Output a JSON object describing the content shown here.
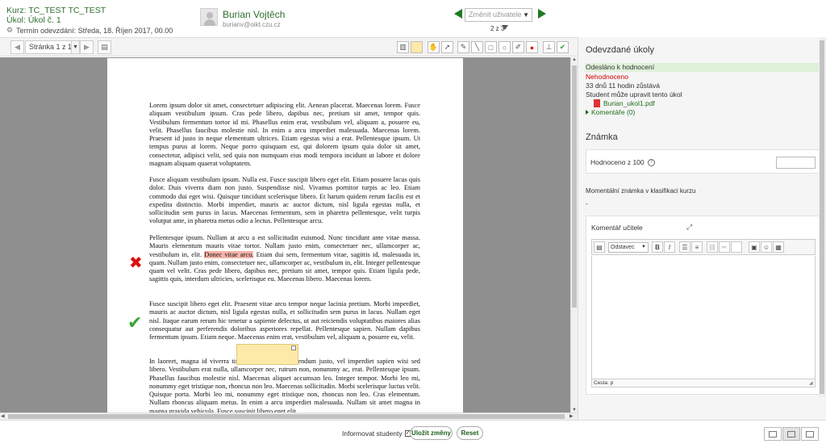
{
  "header": {
    "course": "Kurz: TC_TEST TC_TEST",
    "task": "Úkol: Úkol č. 1",
    "deadline": "Termín odevzdání: Středa, 18. Říjen 2017, 00.00",
    "student_name": "Burian Vojtěch",
    "student_email": "burianv@oikt.czu.cz",
    "change_user_placeholder": "Změnit uživatele",
    "user_count": "2 z 3"
  },
  "toolbar": {
    "page_label": "Stránka 1 z 1"
  },
  "document": {
    "para1": "Lorem ipsum dolor sit amet, consectetuer adipiscing elit. Aenean placerat. Maecenas lorem. Fusce aliquam vestibulum ipsum. Cras pede libero, dapibus nec, pretium sit amet, tempor quis. Vestibulum fermentum tortor id mi. Phasellus enim erat, vestibulum vel, aliquam a, posuere eu, velit. Phasellus faucibus molestie nisl. In enim a arcu imperdiet malesuada. Maecenas lorem. Praesent id justo in neque elementum ultrices. Etiam egestas wisi a erat. Pellentesque ipsum. Ut tempus purus at lorem. Neque porro quisquam est, qui dolorem ipsum quia dolor sit amet, consectetur, adipisci velit, sed quia non numquam eius modi tempora incidunt ut labore et dolore magnam aliquam quaerat voluptatem.",
    "para2": "Fusce aliquam vestibulum ipsum. Nulla est. Fusce suscipit libero eget elit. Etiam posuere lacus quis dolor. Duis viverra diam non justo. Suspendisse nisl. Vivamus porttitor turpis ac leo. Etiam commodo dui eget wisi. Quisque tincidunt scelerisque libero. Et harum quidem rerum facilis est et expedita distinctio. Morbi imperdiet, mauris ac auctor dictum, nisl ligula egestas nulla, et sollicitudin sem purus in lacus. Maecenas fermentum, sem in pharetra pellentesque, velit turpis volutpat ante, in pharetra metus odio a lectus. Pellentesque arcu.",
    "para3_before": "Pellentesque ipsum. Nullam at arcu a est sollicitudin euismod. Nunc tincidunt ante vitae massa. Mauris elementum mauris vitae tortor. Nullam justo enim, consectetuer nec, ullamcorper ac, vestibulum in, elit. ",
    "para3_highlight": "Donec vitae arcu.",
    "para3_after": " Etiam dui sem, fermentum vitae, sagittis id, malesuada in, quam. Nullam justo enim, consectetuer nec, ullamcorper ac, vestibulum in, elit. Integer pellentesque quam vel velit. Cras pede libero, dapibus nec, pretium sit amet, tempor quis. Etiam ligula pede, sagittis quis, interdum ultricies, scelerisque eu. Maecenas libero. Maecenas lorem.",
    "para4": "Fusce suscipit libero eget elit. Praesent vitae arcu tempor neque lacinia pretium. Morbi imperdiet, mauris ac auctor dictum, nisl ligula egestas nulla, et sollicitudin sem purus in lacus. Nullam eget nisl. Itaque earum rerum hic tenetur a sapiente delectus, ut aut reiciendis voluptatibus maiores alias consequatur aut perferendis doloribus asperiores repellat. Pellentesque sapien. Nullam dapibus fermentum ipsum. Etiam neque. Maecenas enim erat, vestibulum vel, aliquam a, posuere eu, velit.",
    "para5": "In laoreet, magna id viverra tincidunt, sem odio bibendum justo, vel imperdiet sapien wisi sed libero. Vestibulum erat nulla, ullamcorper nec, rutrum non, nonummy ac, erat. Pellentesque ipsum. Phasellus faucibus molestie nisl. Maecenas aliquet accumsan leo. Integer tempor. Morbi leo mi, nonummy eget tristique non, rhoncus non leo. Maecenas sollicitudin. Morbi scelerisque luctus velit. Quisque porta. Morbi leo mi, nonummy eget tristique non, rhoncus non leo. Cras elementum. Nullam rhoncus aliquam metus. In enim a arcu imperdiet malesuada. Nullam sit amet magna in magna gravida vehicula. Fusce suscipit libero eget elit."
  },
  "right_panel": {
    "title": "Odevzdané úkoly",
    "sent_status": "Odesláno k hodnocení",
    "grade_status": "Nehodnoceno",
    "time_left": "33 dnů 11 hodin zůstává",
    "edit_note": "Student může upravit tento úkol",
    "file_name": "Burian_ukol1.pdf",
    "comments_link": "Komentáře (0)",
    "grade_title": "Známka",
    "grade_label": "Hodnoceno z 100",
    "moment_label": "Momentální známka v klasifikaci kurzu",
    "moment_value": "-",
    "editor_title": "Komentář učitele",
    "editor_format": "Odstavec",
    "editor_path": "Cesta: p"
  },
  "footer": {
    "notify_label": "Informovat studenty",
    "save_label": "Uložit změny",
    "reset_label": "Reset"
  },
  "colors": {
    "accent_green": "#2f6f2f",
    "status_red": "#cc0000",
    "highlight": "#f7b3a9",
    "comment_yellow": "#fde9a8",
    "sent_bg": "#dff0d8"
  }
}
